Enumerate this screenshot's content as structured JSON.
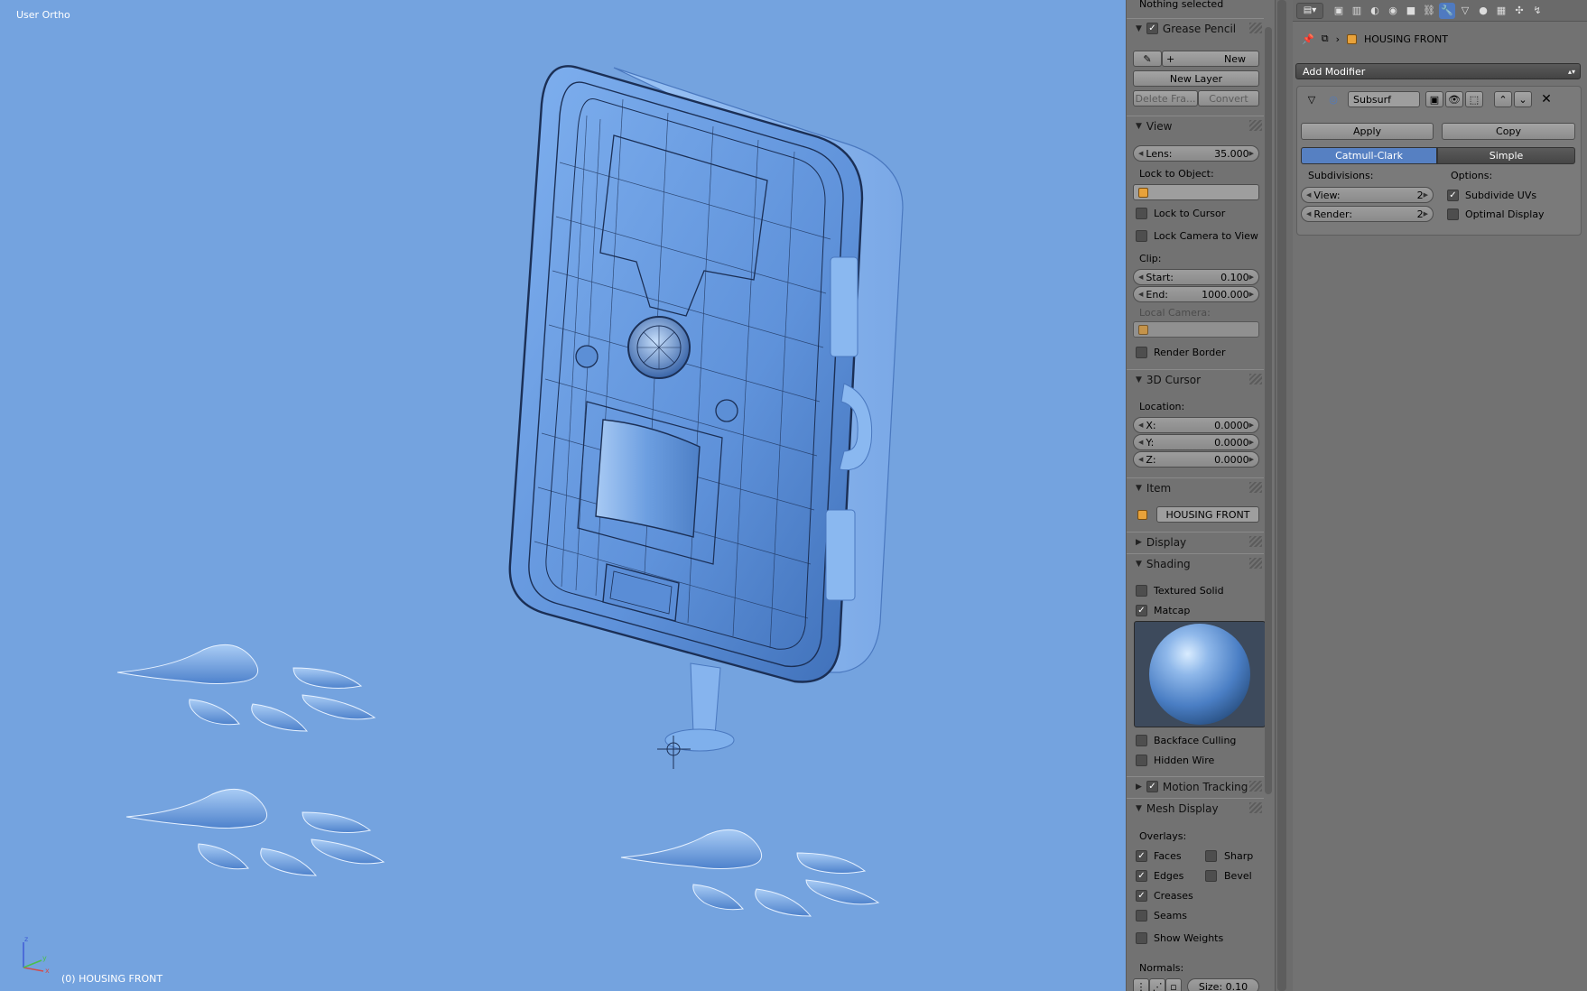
{
  "viewport": {
    "view_label": "User Ortho",
    "object_label": "(0) HOUSING FRONT",
    "background": "#74a3df"
  },
  "npanel": {
    "status": "Nothing selected",
    "grease_pencil": {
      "title": "Grease Pencil",
      "enabled": true,
      "new_label": "New",
      "new_layer_label": "New Layer",
      "delete_frame_label": "Delete Fra...",
      "convert_label": "Convert"
    },
    "view": {
      "title": "View",
      "lens_label": "Lens:",
      "lens_value": "35.000",
      "lock_object_label": "Lock to Object:",
      "lock_cursor_label": "Lock to Cursor",
      "lock_camera_label": "Lock Camera to View",
      "clip_label": "Clip:",
      "clip_start_label": "Start:",
      "clip_start_value": "0.100",
      "clip_end_label": "End:",
      "clip_end_value": "1000.000",
      "local_camera_label": "Local Camera:",
      "render_border_label": "Render Border"
    },
    "cursor": {
      "title": "3D Cursor",
      "location_label": "Location:",
      "x_label": "X:",
      "x_value": "0.0000",
      "y_label": "Y:",
      "y_value": "0.0000",
      "z_label": "Z:",
      "z_value": "0.0000"
    },
    "item": {
      "title": "Item",
      "name": "HOUSING FRONT"
    },
    "display": {
      "title": "Display"
    },
    "shading": {
      "title": "Shading",
      "textured_solid_label": "Textured Solid",
      "matcap_label": "Matcap",
      "matcap_checked": true,
      "backface_label": "Backface Culling",
      "hidden_wire_label": "Hidden Wire"
    },
    "motion_tracking": {
      "title": "Motion Tracking",
      "enabled": true
    },
    "mesh_display": {
      "title": "Mesh Display",
      "overlays_label": "Overlays:",
      "faces_label": "Faces",
      "edges_label": "Edges",
      "creases_label": "Creases",
      "seams_label": "Seams",
      "sharp_label": "Sharp",
      "bevel_label": "Bevel",
      "show_weights_label": "Show Weights",
      "normals_label": "Normals:",
      "size_label": "Size: 0.10"
    }
  },
  "properties": {
    "breadcrumb_object": "HOUSING FRONT",
    "add_modifier_label": "Add Modifier",
    "modifier": {
      "name": "Subsurf",
      "apply_label": "Apply",
      "copy_label": "Copy",
      "catmull_label": "Catmull-Clark",
      "simple_label": "Simple",
      "subdivisions_label": "Subdivisions:",
      "options_label": "Options:",
      "view_label": "View:",
      "view_value": "2",
      "render_label": "Render:",
      "render_value": "2",
      "subdivide_uvs_label": "Subdivide UVs",
      "subdivide_uvs_checked": true,
      "optimal_display_label": "Optimal Display"
    },
    "accent": "#5680c2"
  }
}
